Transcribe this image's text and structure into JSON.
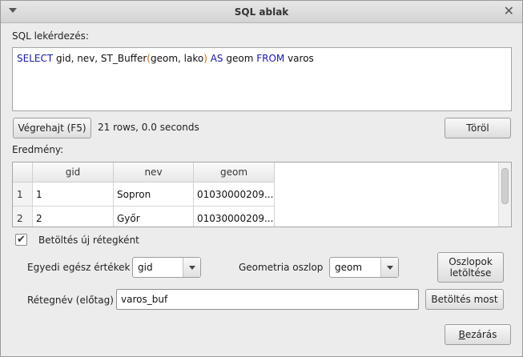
{
  "window": {
    "title": "SQL ablak"
  },
  "query": {
    "label": "SQL lekérdezés:",
    "tokens": [
      {
        "t": "SELECT",
        "c": "kw"
      },
      {
        "t": " gid, nev, ST_Buffer",
        "c": "fn"
      },
      {
        "t": "(",
        "c": "paren"
      },
      {
        "t": "geom, lako",
        "c": "fn"
      },
      {
        "t": ")",
        "c": "paren"
      },
      {
        "t": " AS",
        "c": "kw"
      },
      {
        "t": " geom ",
        "c": "fn"
      },
      {
        "t": "FROM",
        "c": "kw"
      },
      {
        "t": " varos",
        "c": "fn"
      }
    ]
  },
  "actions": {
    "execute_label": "Végrehajt (F5)",
    "status_text": "21 rows, 0.0 seconds",
    "clear_label": "Töröl"
  },
  "results": {
    "label": "Eredmény:",
    "columns": [
      "gid",
      "nev",
      "geom"
    ],
    "rows": [
      {
        "num": "1",
        "cells": [
          "1",
          "Sopron",
          "01030000209..."
        ]
      },
      {
        "num": "2",
        "cells": [
          "2",
          "Győr",
          "01030000209..."
        ]
      }
    ]
  },
  "load_as_layer": {
    "checkbox_label": "Betöltés új rétegként",
    "checked": true,
    "unique_int_label": "Egyedi egész értékek",
    "unique_int_value": "gid",
    "geometry_label": "Geometria oszlop",
    "geometry_value": "geom",
    "fetch_columns_label_line1": "Oszlopok",
    "fetch_columns_label_line2": "letöltése",
    "layer_prefix_label": "Rétegnév (előtag)",
    "layer_prefix_value": "varos_buf",
    "load_now_label": "Betöltés most"
  },
  "footer": {
    "close_label_prefix": "B",
    "close_label_rest": "ezárás"
  }
}
